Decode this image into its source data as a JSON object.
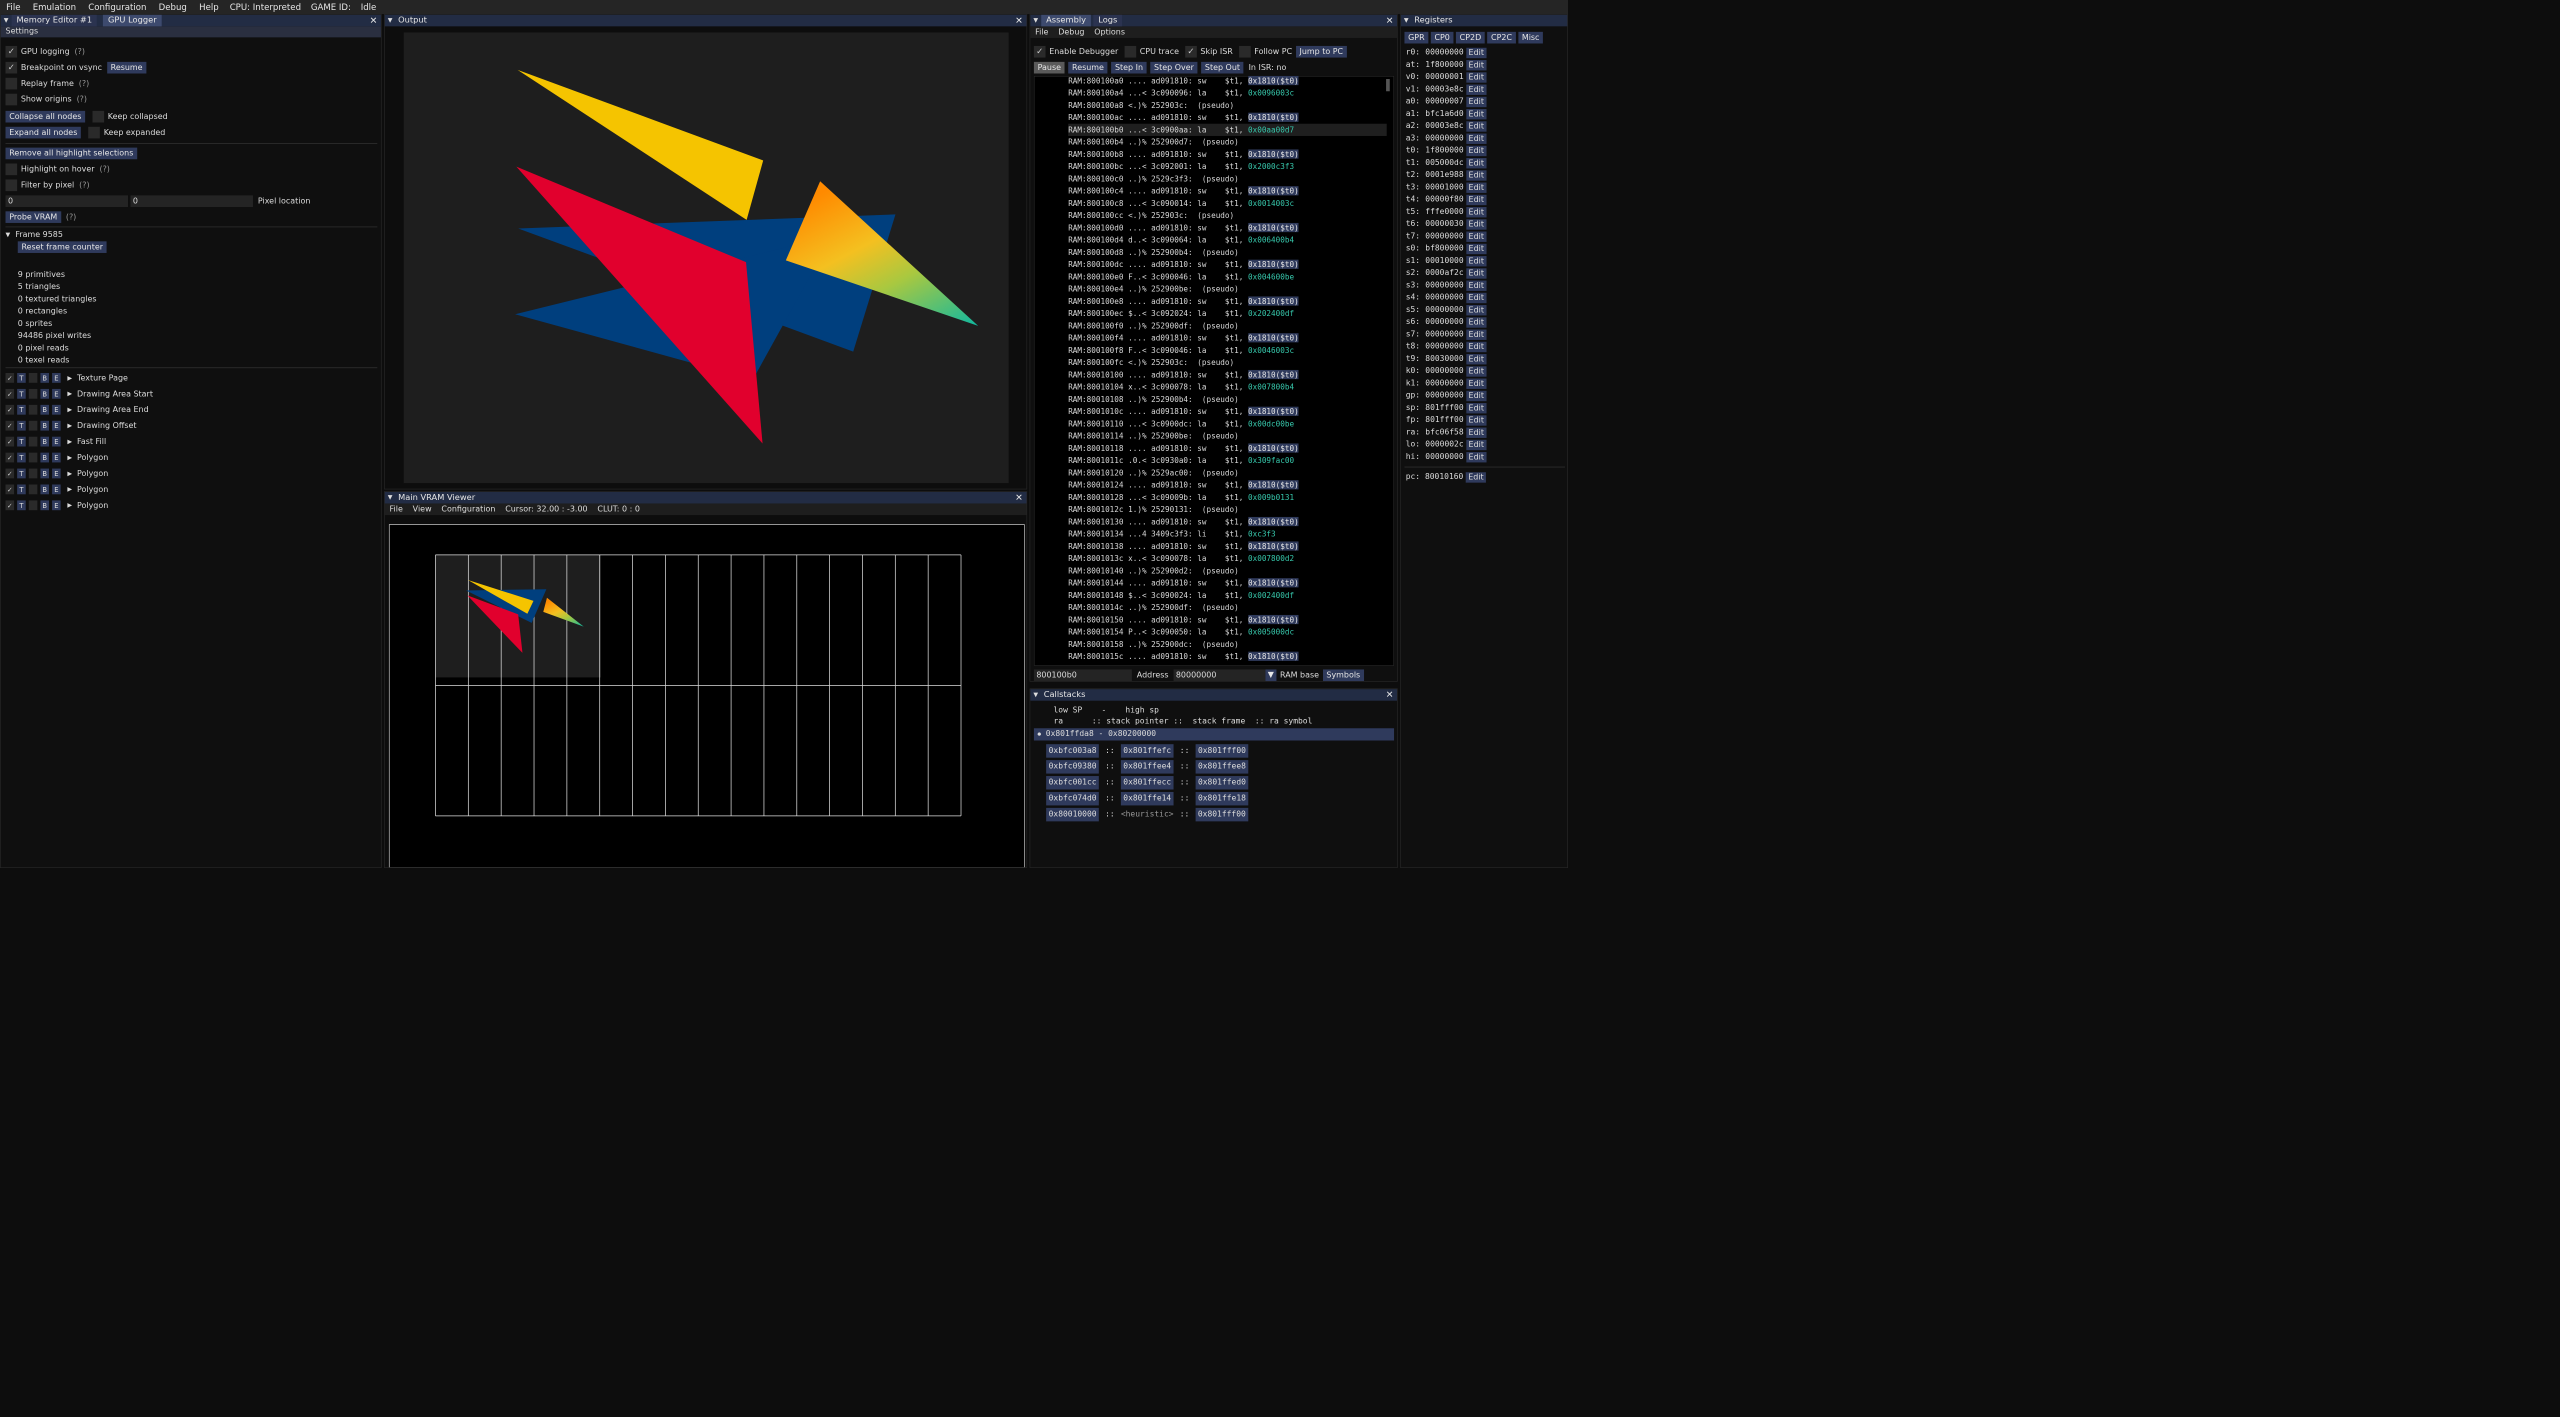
{
  "menubar": {
    "items": [
      "File",
      "Emulation",
      "Configuration",
      "Debug",
      "Help"
    ],
    "cpu": "CPU: Interpreted",
    "gameid": "GAME ID:",
    "state": "Idle"
  },
  "gpu": {
    "tab_memory": "Memory Editor #1",
    "tab_gpu": "GPU Logger",
    "settings": "Settings",
    "gpu_logging": "GPU logging",
    "help": "(?)",
    "bp_vsync": "Breakpoint on vsync",
    "resume": "Resume",
    "replay": "Replay frame",
    "show_origins": "Show origins",
    "collapse": "Collapse all nodes",
    "keep_collapsed": "Keep collapsed",
    "expand": "Expand all nodes",
    "keep_expanded": "Keep expanded",
    "remove_hl": "Remove all highlight selections",
    "hl_hover": "Highlight on hover",
    "filter_pixel": "Filter by pixel",
    "px": "0",
    "py": "0",
    "pixel_location": "Pixel location",
    "probe": "Probe VRAM",
    "frame": "Frame 9585",
    "reset": "Reset frame counter",
    "stats": [
      "9 primitives",
      "5 triangles",
      "0 textured triangles",
      "0 rectangles",
      "0 sprites",
      "94486 pixel writes",
      "0 pixel reads",
      "0 texel reads"
    ],
    "T": "T",
    "B": "B",
    "E": "E",
    "nodes": [
      "Texture Page",
      "Drawing Area Start",
      "Drawing Area End",
      "Drawing Offset",
      "Fast Fill",
      "Polygon",
      "Polygon",
      "Polygon",
      "Polygon"
    ]
  },
  "output": {
    "title": "Output"
  },
  "vram": {
    "title": "Main VRAM Viewer",
    "menus": [
      "File",
      "View",
      "Configuration"
    ],
    "cursor": "Cursor: 32.00 : -3.00",
    "clut": "CLUT: 0 : 0"
  },
  "asm": {
    "tab_asm": "Assembly",
    "tab_logs": "Logs",
    "menus": [
      "File",
      "Debug",
      "Options"
    ],
    "enable": "Enable Debugger",
    "cputrace": "CPU trace",
    "skipisr": "Skip ISR",
    "followpc": "Follow PC",
    "jump": "Jump to PC",
    "pause": "Pause",
    "resume": "Resume",
    "stepin": "Step In",
    "stepover": "Step Over",
    "stepout": "Step Out",
    "inisr": "In ISR: no",
    "lines": [
      [
        "RAM:800100a0 .... ad091810: sw",
        "$t1, ",
        "0x1810($t0)",
        "s"
      ],
      [
        "RAM:800100a4 ...< 3c090096: la",
        "$t1, ",
        "0x0096003c",
        "l"
      ],
      [
        "RAM:800100a8 <.)% 252903c:  (pseudo)",
        "",
        "",
        "p"
      ],
      [
        "RAM:800100ac .... ad091810: sw",
        "$t1, ",
        "0x1810($t0)",
        "s"
      ],
      [
        "RAM:800100b0 ...< 3c0900aa: la",
        "$t1, ",
        "0x00aa00d7",
        "l"
      ],
      [
        "RAM:800100b4 ..)% 252900d7:  (pseudo)",
        "",
        "",
        "p"
      ],
      [
        "RAM:800100b8 .... ad091810: sw",
        "$t1, ",
        "0x1810($t0)",
        "s"
      ],
      [
        "RAM:800100bc ...< 3c092001: la",
        "$t1, ",
        "0x2000c3f3",
        "l"
      ],
      [
        "RAM:800100c0 ..)% 2529c3f3:  (pseudo)",
        "",
        "",
        "p"
      ],
      [
        "RAM:800100c4 .... ad091810: sw",
        "$t1, ",
        "0x1810($t0)",
        "s"
      ],
      [
        "RAM:800100c8 ...< 3c090014: la",
        "$t1, ",
        "0x0014003c",
        "l"
      ],
      [
        "RAM:800100cc <.)% 252903c:  (pseudo)",
        "",
        "",
        "p"
      ],
      [
        "RAM:800100d0 .... ad091810: sw",
        "$t1, ",
        "0x1810($t0)",
        "s"
      ],
      [
        "RAM:800100d4 d..< 3c090064: la",
        "$t1, ",
        "0x006400b4",
        "l"
      ],
      [
        "RAM:800100d8 ..)% 252900b4:  (pseudo)",
        "",
        "",
        "p"
      ],
      [
        "RAM:800100dc .... ad091810: sw",
        "$t1, ",
        "0x1810($t0)",
        "s"
      ],
      [
        "RAM:800100e0 F..< 3c090046: la",
        "$t1, ",
        "0x004600be",
        "l"
      ],
      [
        "RAM:800100e4 ..)% 252900be:  (pseudo)",
        "",
        "",
        "p"
      ],
      [
        "RAM:800100e8 .... ad091810: sw",
        "$t1, ",
        "0x1810($t0)",
        "s"
      ],
      [
        "RAM:800100ec $..< 3c092024: la",
        "$t1, ",
        "0x202400df",
        "l"
      ],
      [
        "RAM:800100f0 ..)% 252900df:  (pseudo)",
        "",
        "",
        "p"
      ],
      [
        "RAM:800100f4 .... ad091810: sw",
        "$t1, ",
        "0x1810($t0)",
        "s"
      ],
      [
        "RAM:800100f8 F..< 3c090046: la",
        "$t1, ",
        "0x0046003c",
        "l"
      ],
      [
        "RAM:800100fc <.)% 252903c:  (pseudo)",
        "",
        "",
        "p"
      ],
      [
        "RAM:80010100 .... ad091810: sw",
        "$t1, ",
        "0x1810($t0)",
        "s"
      ],
      [
        "RAM:80010104 x..< 3c090078: la",
        "$t1, ",
        "0x007800b4",
        "l"
      ],
      [
        "RAM:80010108 ..)% 252900b4:  (pseudo)",
        "",
        "",
        "p"
      ],
      [
        "RAM:8001010c .... ad091810: sw",
        "$t1, ",
        "0x1810($t0)",
        "s"
      ],
      [
        "RAM:80010110 ...< 3c0900dc: la",
        "$t1, ",
        "0x00dc00be",
        "l"
      ],
      [
        "RAM:80010114 ..)% 252900be:  (pseudo)",
        "",
        "",
        "p"
      ],
      [
        "RAM:80010118 .... ad091810: sw",
        "$t1, ",
        "0x1810($t0)",
        "s"
      ],
      [
        "RAM:8001011c .0.< 3c0930a0: la",
        "$t1, ",
        "0x309fac00",
        "l"
      ],
      [
        "RAM:80010120 ..)% 2529ac00:  (pseudo)",
        "",
        "",
        "p"
      ],
      [
        "RAM:80010124 .... ad091810: sw",
        "$t1, ",
        "0x1810($t0)",
        "s"
      ],
      [
        "RAM:80010128 ...< 3c09009b: la",
        "$t1, ",
        "0x009b0131",
        "l"
      ],
      [
        "RAM:8001012c 1.)% 25290131:  (pseudo)",
        "",
        "",
        "p"
      ],
      [
        "RAM:80010130 .... ad091810: sw",
        "$t1, ",
        "0x1810($t0)",
        "s"
      ],
      [
        "RAM:80010134 ...4 3409c3f3: li",
        "$t1, ",
        "0xc3f3",
        "l"
      ],
      [
        "RAM:80010138 .... ad091810: sw",
        "$t1, ",
        "0x1810($t0)",
        "s"
      ],
      [
        "RAM:8001013c x..< 3c090078: la",
        "$t1, ",
        "0x007800d2",
        "l"
      ],
      [
        "RAM:80010140 ..)% 252900d2:  (pseudo)",
        "",
        "",
        "p"
      ],
      [
        "RAM:80010144 .... ad091810: sw",
        "$t1, ",
        "0x1810($t0)",
        "s"
      ],
      [
        "RAM:80010148 $..< 3c090024: la",
        "$t1, ",
        "0x002400df",
        "l"
      ],
      [
        "RAM:8001014c ..)% 252900df:  (pseudo)",
        "",
        "",
        "p"
      ],
      [
        "RAM:80010150 .... ad091810: sw",
        "$t1, ",
        "0x1810($t0)",
        "s"
      ],
      [
        "RAM:80010154 P..< 3c090050: la",
        "$t1, ",
        "0x005000dc",
        "l"
      ],
      [
        "RAM:80010158 ..)% 252900dc:  (pseudo)",
        "",
        "",
        "p"
      ],
      [
        "RAM:8001015c .... ad091810: sw",
        "$t1, ",
        "0x1810($t0)",
        "s"
      ]
    ],
    "addr_input": "800100b0",
    "address": "Address",
    "rambase_val": "80000000",
    "rambase": "RAM base",
    "symbols": "Symbols"
  },
  "callstacks": {
    "title": "Callstacks",
    "h1": "low SP    -    high sp",
    "h2": "ra      :: stack pointer ::  stack frame  :: ra symbol",
    "range": "0x801ffda8 - 0x80200000",
    "rows": [
      [
        "0xbfc003a8",
        "::",
        "0x801ffefc",
        "::",
        "0x801fff00"
      ],
      [
        "0xbfc09380",
        "::",
        "0x801ffee4",
        "::",
        "0x801ffee8"
      ],
      [
        "0xbfc001cc",
        "::",
        "0x801ffecc",
        "::",
        "0x801ffed0"
      ],
      [
        "0xbfc074d0",
        "::",
        "0x801ffe14",
        "::",
        "0x801ffe18"
      ],
      [
        "0x80010000",
        "::",
        "<heuristic>",
        "::",
        "0x801fff00"
      ]
    ]
  },
  "registers": {
    "title": "Registers",
    "tabs": [
      "GPR",
      "CP0",
      "CP2D",
      "CP2C",
      "Misc"
    ],
    "edit": "Edit",
    "regs": [
      [
        "r0:",
        "00000000"
      ],
      [
        "at:",
        "1f800000"
      ],
      [
        "v0:",
        "00000001"
      ],
      [
        "v1:",
        "00003e8c"
      ],
      [
        "a0:",
        "00000007"
      ],
      [
        "a1:",
        "bfc1a6d0"
      ],
      [
        "a2:",
        "00003e8c"
      ],
      [
        "a3:",
        "00000000"
      ],
      [
        "t0:",
        "1f800000"
      ],
      [
        "t1:",
        "005000dc"
      ],
      [
        "t2:",
        "0001e988"
      ],
      [
        "t3:",
        "00001000"
      ],
      [
        "t4:",
        "00000f80"
      ],
      [
        "t5:",
        "fffe0000"
      ],
      [
        "t6:",
        "00000030"
      ],
      [
        "t7:",
        "00000000"
      ],
      [
        "s0:",
        "bf800000"
      ],
      [
        "s1:",
        "00010000"
      ],
      [
        "s2:",
        "0000af2c"
      ],
      [
        "s3:",
        "00000000"
      ],
      [
        "s4:",
        "00000000"
      ],
      [
        "s5:",
        "00000000"
      ],
      [
        "s6:",
        "00000000"
      ],
      [
        "s7:",
        "00000000"
      ],
      [
        "t8:",
        "00000000"
      ],
      [
        "t9:",
        "80030000"
      ],
      [
        "k0:",
        "00000000"
      ],
      [
        "k1:",
        "00000000"
      ],
      [
        "gp:",
        "00000000"
      ],
      [
        "sp:",
        "801fff00"
      ],
      [
        "fp:",
        "801fff00"
      ],
      [
        "ra:",
        "bfc06f58"
      ],
      [
        "lo:",
        "0000002c"
      ],
      [
        "hi:",
        "00000000"
      ]
    ],
    "pc": [
      "pc:",
      "80010160"
    ]
  },
  "colors": {
    "yellow": "#f5c400",
    "red": "#e1002d",
    "blue": "#003f7e",
    "titlebar": "#222c44",
    "button": "#2f3a5c",
    "cyan": "#37c8ac"
  }
}
